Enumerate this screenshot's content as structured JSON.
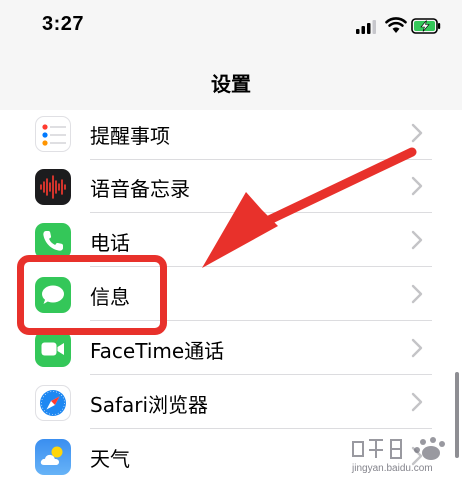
{
  "status_bar": {
    "time": "3:27"
  },
  "header": {
    "title": "设置"
  },
  "settings_items": [
    {
      "label": "提醒事项",
      "icon": "reminders-icon"
    },
    {
      "label": "语音备忘录",
      "icon": "voice-memos-icon"
    },
    {
      "label": "电话",
      "icon": "phone-icon"
    },
    {
      "label": "信息",
      "icon": "messages-icon"
    },
    {
      "label": "FaceTime通话",
      "icon": "facetime-icon"
    },
    {
      "label": "Safari浏览器",
      "icon": "safari-icon"
    },
    {
      "label": "天气",
      "icon": "weather-icon"
    }
  ],
  "watermark": {
    "text": "jingyan.baidu.com"
  },
  "colors": {
    "annotation_red": "#e8312b",
    "chevron": "#c4c4c7",
    "messages_green": "#34c759",
    "battery_green": "#34c759"
  }
}
